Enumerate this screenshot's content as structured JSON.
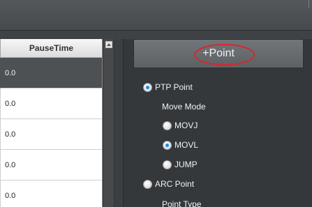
{
  "table": {
    "header": "PauseTime",
    "rows": [
      "0.0",
      "0.0",
      "0.0",
      "0.0",
      "0.0"
    ],
    "selected_row": 0
  },
  "panel": {
    "add_point_label": "+Point",
    "ptp_point_label": "PTP Point",
    "move_mode_label": "Move Mode",
    "movj_label": "MOVJ",
    "movl_label": "MOVL",
    "jump_label": "JUMP",
    "arc_point_label": "ARC Point",
    "point_type_label": "Point Type",
    "point_mode": "PTP Point",
    "move_mode": "MOVL"
  },
  "colors": {
    "highlight": "#d8262c",
    "radio_selected": "#1b8de0"
  }
}
